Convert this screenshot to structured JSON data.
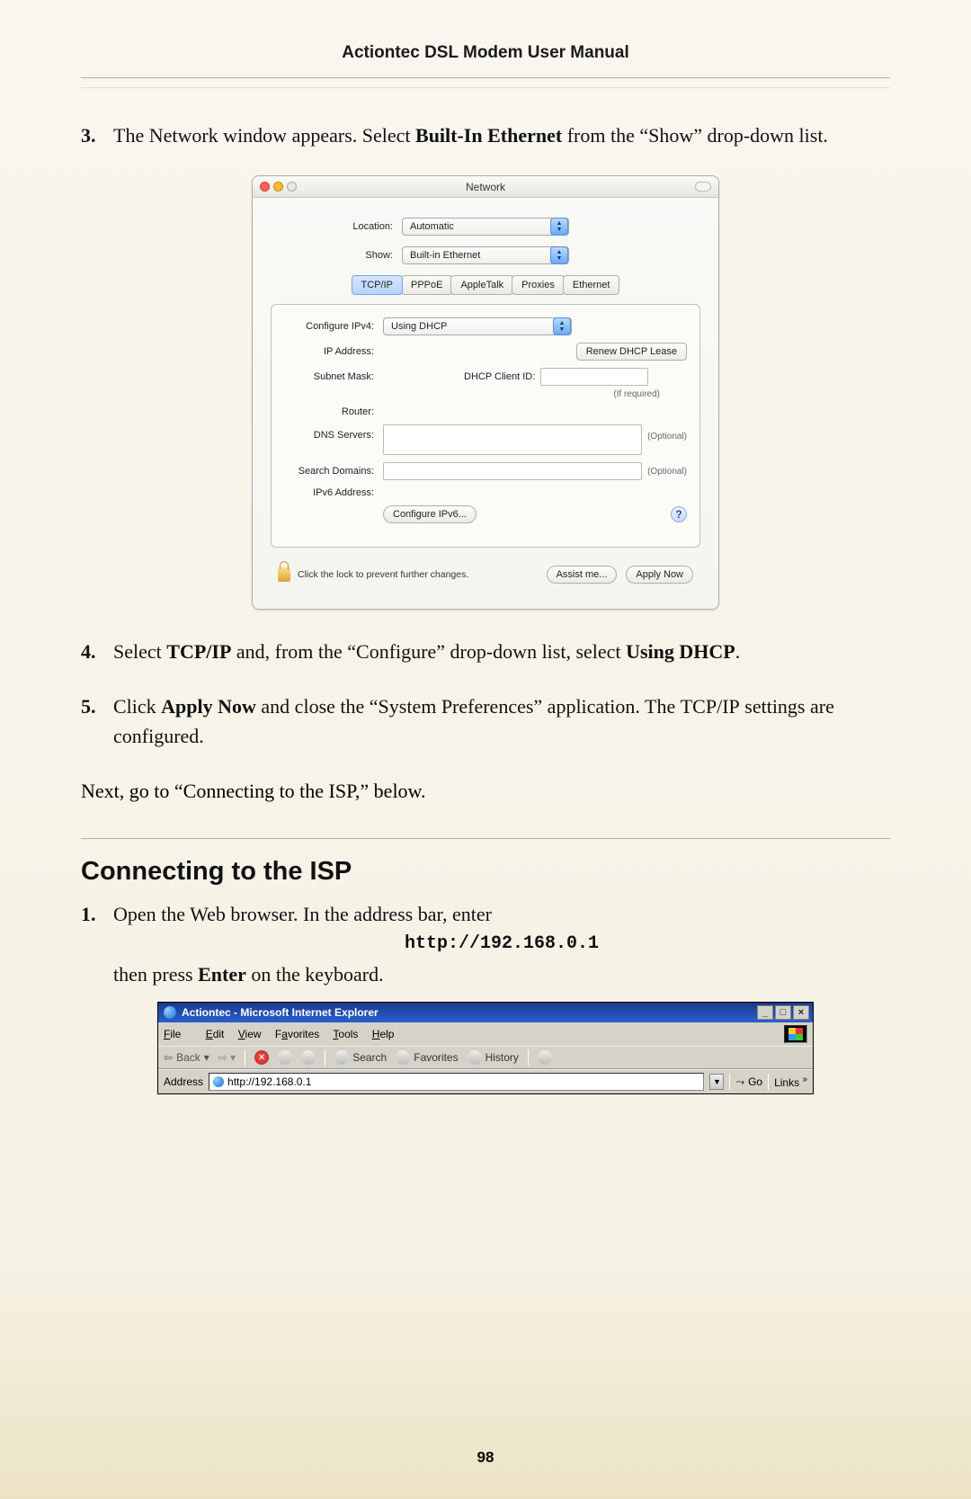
{
  "header": {
    "title": "Actiontec DSL Modem User Manual"
  },
  "steps_top": {
    "3": {
      "num": "3.",
      "text_before": "The Network window appears. Select ",
      "bold": "Built-In Ethernet",
      "text_after": " from the “Show” drop-down list."
    }
  },
  "mac": {
    "title": "Network",
    "location_label": "Location:",
    "location_value": "Automatic",
    "show_label": "Show:",
    "show_value": "Built-in Ethernet",
    "tabs": [
      "TCP/IP",
      "PPPoE",
      "AppleTalk",
      "Proxies",
      "Ethernet"
    ],
    "panel": {
      "configure_label": "Configure IPv4:",
      "configure_value": "Using DHCP",
      "ip_label": "IP Address:",
      "renew_btn": "Renew DHCP Lease",
      "subnet_label": "Subnet Mask:",
      "dhcp_client_label": "DHCP Client ID:",
      "if_required": "(If required)",
      "router_label": "Router:",
      "dns_label": "DNS Servers:",
      "optional": "(Optional)",
      "search_label": "Search Domains:",
      "ipv6addr_label": "IPv6 Address:",
      "configure_ipv6_btn": "Configure IPv6..."
    },
    "footer": {
      "lock_text": "Click the lock to prevent further changes.",
      "assist_btn": "Assist me...",
      "apply_btn": "Apply Now"
    }
  },
  "steps_bottom": {
    "4": {
      "num": "4.",
      "parts": [
        "Select ",
        "TCP/IP",
        " and, from the “Configure” drop-down list, select ",
        "Using DHCP",
        "."
      ]
    },
    "5": {
      "num": "5.",
      "parts": [
        "Click ",
        "Apply Now",
        " and close the “System Preferences” application. The ",
        "TCP/IP",
        " settings are configured."
      ]
    },
    "next": "Next, go to “Connecting to the ISP,” below."
  },
  "section": {
    "heading": "Connecting to the ISP",
    "step1_num": "1.",
    "step1_a": "Open the Web browser. In the address bar, enter",
    "url": "http://192.168.0.1",
    "step1_b_before": "then press ",
    "step1_b_bold": "Enter",
    "step1_b_after": " on the keyboard."
  },
  "ie": {
    "title": "Actiontec - Microsoft Internet Explorer",
    "menu": {
      "file": "File",
      "edit": "Edit",
      "view": "View",
      "favorites": "Favorites",
      "tools": "Tools",
      "help": "Help"
    },
    "toolbar": {
      "back": "Back",
      "search": "Search",
      "favorites": "Favorites",
      "history": "History"
    },
    "address_label": "Address",
    "address_value": "http://192.168.0.1",
    "go": "Go",
    "links": "Links"
  },
  "page_number": "98"
}
